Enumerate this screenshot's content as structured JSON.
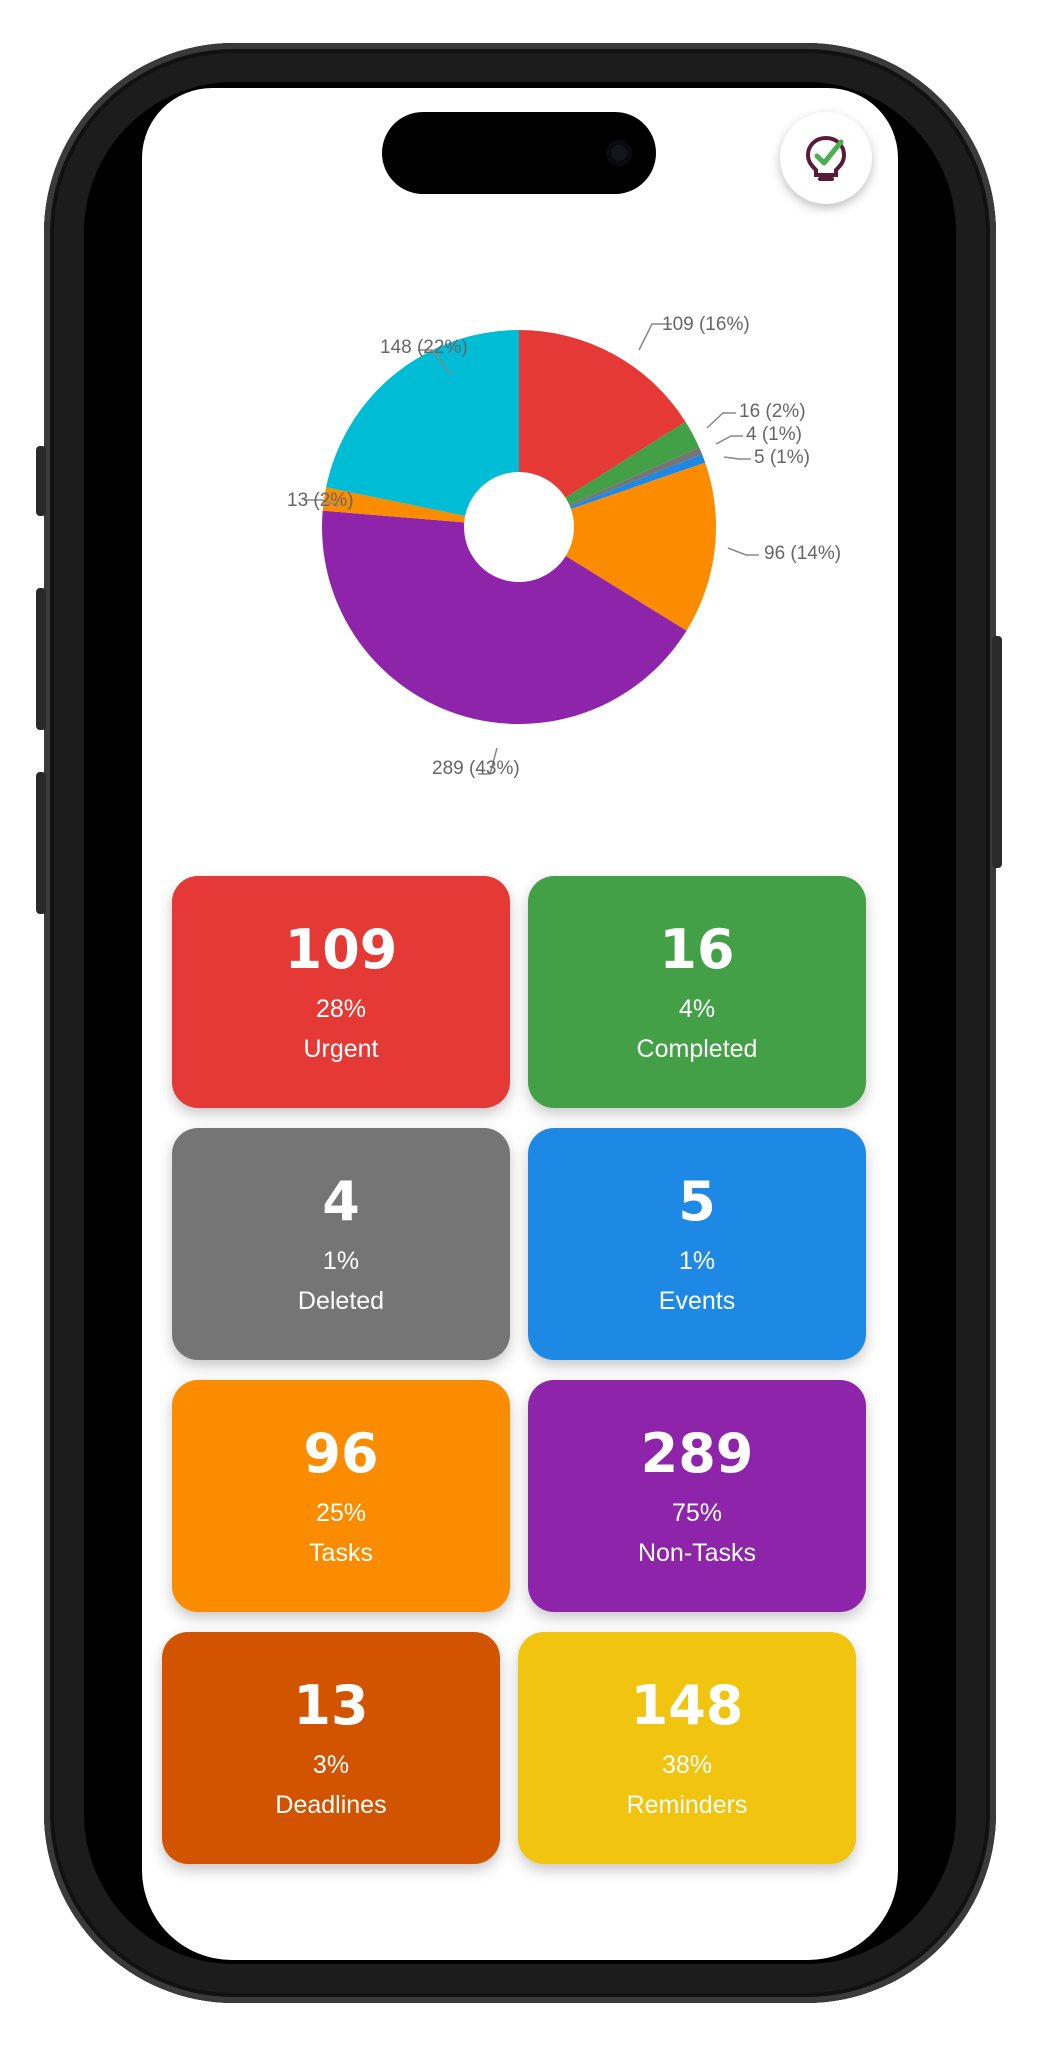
{
  "app": {
    "logo_icon": "lightbulb-check-icon",
    "colors": {
      "urgent": "#e53935",
      "completed": "#43a047",
      "deleted": "#757575",
      "events": "#1e88e5",
      "tasks": "#fb8c00",
      "non_tasks": "#8e24aa",
      "deadlines": "#d35400",
      "reminders": "#f1c40f",
      "pie_cyan": "#00bcd4"
    }
  },
  "chart_data": {
    "type": "pie",
    "donut": true,
    "slices": [
      {
        "value": 109,
        "label": "109 (16%)",
        "color": "#e53935"
      },
      {
        "value": 16,
        "label": "16 (2%)",
        "color": "#43a047"
      },
      {
        "value": 4,
        "label": "4 (1%)",
        "color": "#757575"
      },
      {
        "value": 5,
        "label": "5 (1%)",
        "color": "#1e88e5"
      },
      {
        "value": 96,
        "label": "96 (14%)",
        "color": "#fb8c00"
      },
      {
        "value": 289,
        "label": "289 (43%)",
        "color": "#8e24aa"
      },
      {
        "value": 13,
        "label": "13 (2%)",
        "color": "#fb8c00"
      },
      {
        "value": 148,
        "label": "148 (22%)",
        "color": "#00bcd4"
      }
    ]
  },
  "cards": [
    {
      "count": "109",
      "percent": "28%",
      "label": "Urgent",
      "color": "#e53935"
    },
    {
      "count": "16",
      "percent": "4%",
      "label": "Completed",
      "color": "#43a047"
    },
    {
      "count": "4",
      "percent": "1%",
      "label": "Deleted",
      "color": "#757575"
    },
    {
      "count": "5",
      "percent": "1%",
      "label": "Events",
      "color": "#1e88e5"
    },
    {
      "count": "96",
      "percent": "25%",
      "label": "Tasks",
      "color": "#fb8c00"
    },
    {
      "count": "289",
      "percent": "75%",
      "label": "Non-Tasks",
      "color": "#8e24aa"
    },
    {
      "count": "13",
      "percent": "3%",
      "label": "Deadlines",
      "color": "#d35400"
    },
    {
      "count": "148",
      "percent": "38%",
      "label": "Reminders",
      "color": "#f1c40f"
    }
  ]
}
